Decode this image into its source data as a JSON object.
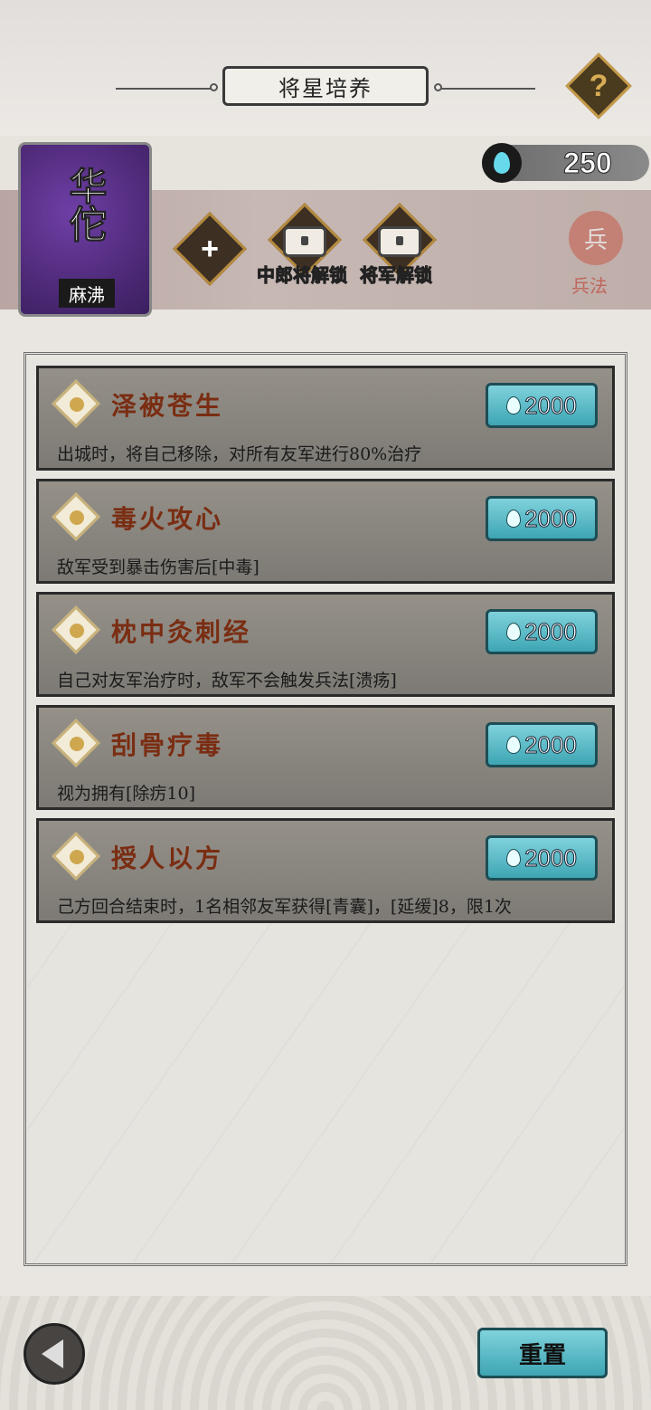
{
  "header": {
    "title": "将星培养",
    "help_label": "?"
  },
  "currency": {
    "value": "250",
    "icon": "blue-flame-icon"
  },
  "hero": {
    "name": "华佗",
    "trait": "麻沸"
  },
  "slots": {
    "add_label": "+",
    "lock1_label": "中郎将解锁",
    "lock2_label": "将军解锁"
  },
  "bingfa": {
    "icon_text": "兵",
    "label": "兵法"
  },
  "skills": [
    {
      "name": "泽被苍生",
      "cost": "2000",
      "desc": "出城时，将自己移除，对所有友军进行80%治疗"
    },
    {
      "name": "毒火攻心",
      "cost": "2000",
      "desc": "敌军受到暴击伤害后[中毒]"
    },
    {
      "name": "枕中灸刺经",
      "cost": "2000",
      "desc": "自己对友军治疗时，敌军不会触发兵法[溃疡]"
    },
    {
      "name": "刮骨疗毒",
      "cost": "2000",
      "desc": "视为拥有[除疠10]"
    },
    {
      "name": "授人以方",
      "cost": "2000",
      "desc": "己方回合结束时，1名相邻友军获得[青囊]，[延缓]8，限1次"
    }
  ],
  "footer": {
    "reset_label": "重置"
  },
  "colors": {
    "accent": "#3ea5b3",
    "skill_name": "#7a2d12",
    "hero_bg": "#4a2772"
  }
}
